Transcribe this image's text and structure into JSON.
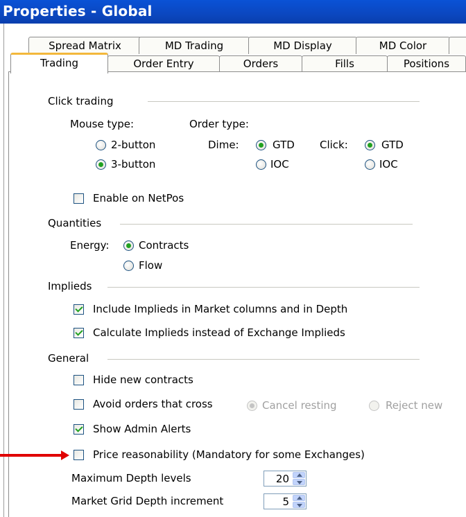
{
  "window": {
    "title": "Properties - Global"
  },
  "tabs_row1": [
    {
      "label": "Spread Matrix"
    },
    {
      "label": "MD Trading"
    },
    {
      "label": "MD Display"
    },
    {
      "label": "MD Color"
    }
  ],
  "tabs_row2": [
    {
      "label": "Trading",
      "active": true
    },
    {
      "label": "Order Entry"
    },
    {
      "label": "Orders"
    },
    {
      "label": "Fills"
    },
    {
      "label": "Positions"
    }
  ],
  "click_trading": {
    "header": "Click trading",
    "mouse_type_label": "Mouse type:",
    "order_type_label": "Order type:",
    "mouse_options": [
      {
        "label": "2-button",
        "selected": false
      },
      {
        "label": "3-button",
        "selected": true
      }
    ],
    "dime_label": "Dime:",
    "click_label": "Click:",
    "dime_options": [
      {
        "label": "GTD",
        "selected": true
      },
      {
        "label": "IOC",
        "selected": false
      }
    ],
    "click_options": [
      {
        "label": "GTD",
        "selected": true
      },
      {
        "label": "IOC",
        "selected": false
      }
    ],
    "enable_netpos": {
      "label": "Enable on NetPos",
      "checked": false
    }
  },
  "quantities": {
    "header": "Quantities",
    "energy_label": "Energy:",
    "options": [
      {
        "label": "Contracts",
        "selected": true
      },
      {
        "label": "Flow",
        "selected": false
      }
    ]
  },
  "implieds": {
    "header": "Implieds",
    "include": {
      "label": "Include Implieds in Market columns and in Depth",
      "checked": true
    },
    "calculate": {
      "label": "Calculate Implieds instead of Exchange Implieds",
      "checked": true
    }
  },
  "general": {
    "header": "General",
    "hide_new": {
      "label": "Hide new contracts",
      "checked": false
    },
    "avoid_cross": {
      "label": "Avoid orders that cross",
      "checked": false
    },
    "cancel_resting": {
      "label": "Cancel resting",
      "selected": true,
      "disabled": true
    },
    "reject_new": {
      "label": "Reject new",
      "selected": false,
      "disabled": true
    },
    "admin_alerts": {
      "label": "Show Admin Alerts",
      "checked": true
    },
    "price_reason": {
      "label": "Price reasonability (Mandatory for some Exchanges)",
      "checked": false
    },
    "max_depth": {
      "label": "Maximum Depth levels",
      "value": "20"
    },
    "grid_depth": {
      "label": "Market Grid Depth increment",
      "value": "5"
    }
  },
  "colors": {
    "titlebar": "#0a4bc8",
    "check_green": "#21a121",
    "active_tab_accent": "#f3b83b",
    "arrow": "#e00000"
  }
}
